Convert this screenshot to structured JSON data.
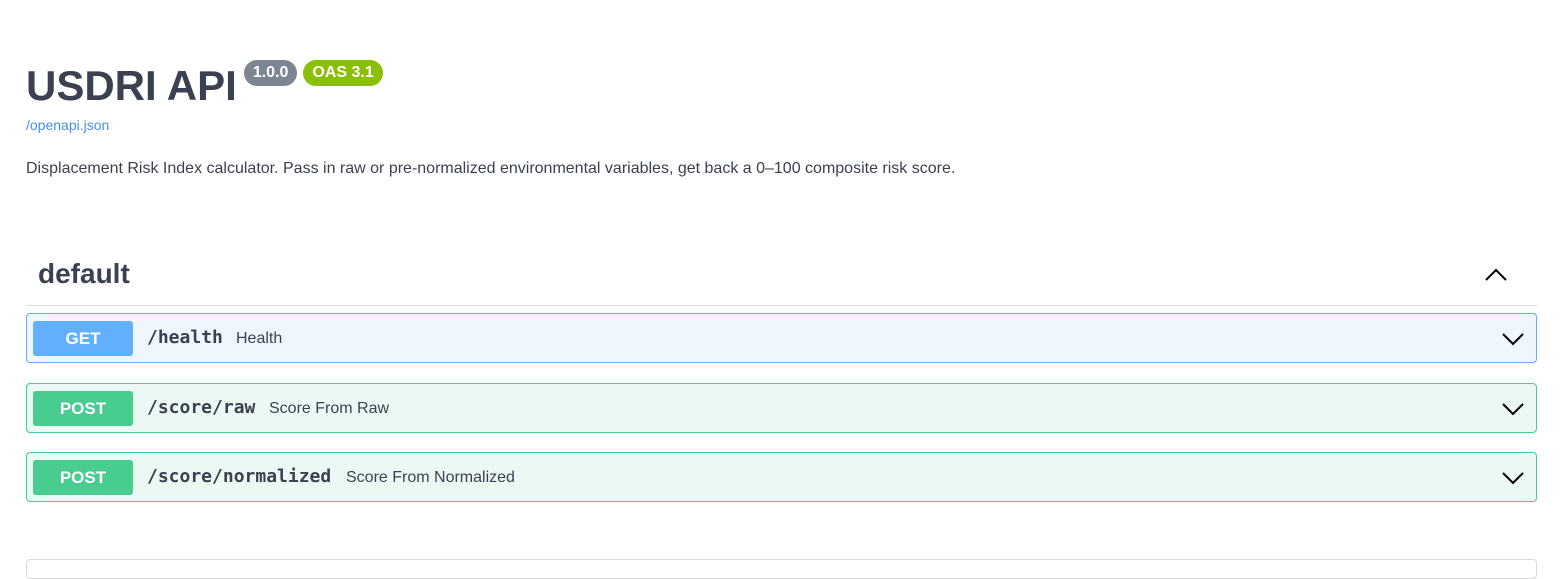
{
  "info": {
    "title": "USDRI API",
    "version": "1.0.0",
    "oas_version": "OAS 3.1",
    "spec_link": "/openapi.json",
    "description": "Displacement Risk Index calculator. Pass in raw or pre-normalized environmental variables, get back a 0–100 composite risk score."
  },
  "tag": {
    "name": "default",
    "collapse_icon": "chevron-up-icon"
  },
  "operations": [
    {
      "method": "GET",
      "path": "/health",
      "summary": "Health",
      "color": "#61affe",
      "expand_icon": "chevron-down-icon"
    },
    {
      "method": "POST",
      "path": "/score/raw",
      "summary": "Score From Raw",
      "color": "#49cc90",
      "expand_icon": "chevron-down-icon"
    },
    {
      "method": "POST",
      "path": "/score/normalized",
      "summary": "Score From Normalized",
      "color": "#49cc90",
      "expand_icon": "chevron-down-icon"
    }
  ],
  "colors": {
    "text": "#3b4151",
    "link": "#4990e2",
    "version_badge": "#7d8492",
    "oas_badge": "#89bf04",
    "get_bg": "#eff6fe",
    "post_bg": "#ebf8f3"
  }
}
